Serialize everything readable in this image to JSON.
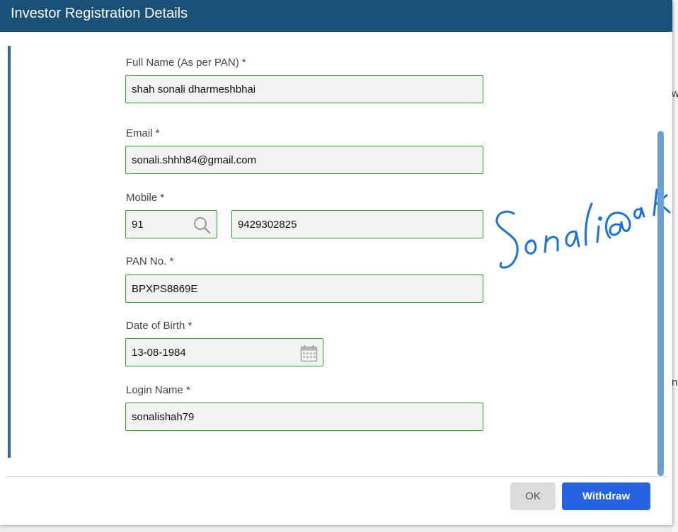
{
  "dialog": {
    "title": "Investor Registration Details"
  },
  "background_fragments": [
    "w",
    "n"
  ],
  "form": {
    "full_name": {
      "label": "Full Name (As per PAN) *",
      "value": "shah sonali dharmeshbhai"
    },
    "email": {
      "label": "Email *",
      "value": "sonali.shhh84@gmail.com"
    },
    "mobile": {
      "label": "Mobile *",
      "country_code": "91",
      "number": "9429302825",
      "search_icon": "search-icon"
    },
    "pan": {
      "label": "PAN No. *",
      "value": "BPXPS8869E"
    },
    "dob": {
      "label": "Date of Birth *",
      "value": "13-08-1984",
      "calendar_icon": "calendar-icon"
    },
    "login_name": {
      "label": "Login Name *",
      "value": "sonalishah79"
    }
  },
  "signature": {
    "text": "Sonali@ak"
  },
  "footer": {
    "ok_label": "OK",
    "withdraw_label": "Withdraw"
  },
  "colors": {
    "titlebar": "#1b5176",
    "field_border": "#22b022",
    "field_bg": "#f2f2f2",
    "primary_button": "#2563e0",
    "signature_ink": "#1a73d9"
  }
}
